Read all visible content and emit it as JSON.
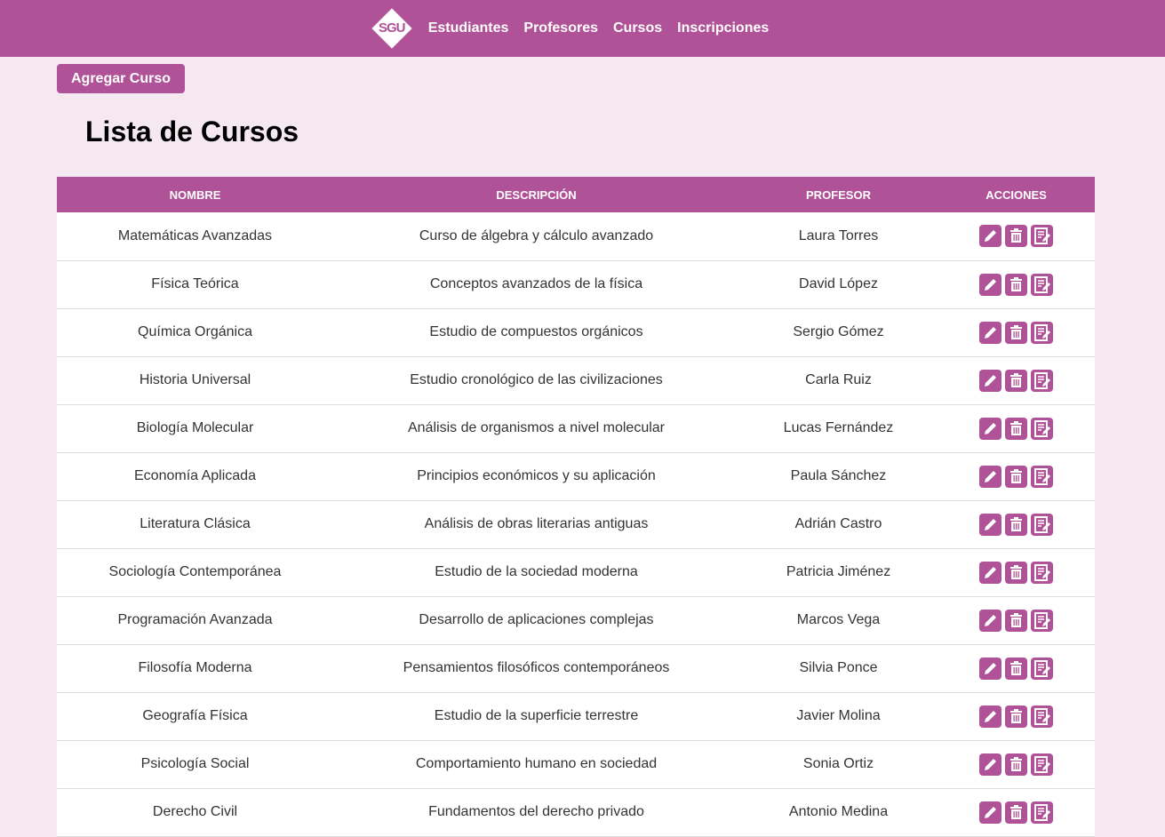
{
  "nav": {
    "logo": "SGU",
    "items": [
      "Estudiantes",
      "Profesores",
      "Cursos",
      "Inscripciones"
    ]
  },
  "add_button": "Agregar Curso",
  "title": "Lista de Cursos",
  "columns": [
    "NOMBRE",
    "DESCRIPCIÓN",
    "PROFESOR",
    "ACCIONES"
  ],
  "rows": [
    [
      "Matemáticas Avanzadas",
      "Curso de álgebra y cálculo avanzado",
      "Laura Torres"
    ],
    [
      "Física Teórica",
      "Conceptos avanzados de la física",
      "David López"
    ],
    [
      "Química Orgánica",
      "Estudio de compuestos orgánicos",
      "Sergio Gómez"
    ],
    [
      "Historia Universal",
      "Estudio cronológico de las civilizaciones",
      "Carla Ruiz"
    ],
    [
      "Biología Molecular",
      "Análisis de organismos a nivel molecular",
      "Lucas Fernández"
    ],
    [
      "Economía Aplicada",
      "Principios económicos y su aplicación",
      "Paula Sánchez"
    ],
    [
      "Literatura Clásica",
      "Análisis de obras literarias antiguas",
      "Adrián Castro"
    ],
    [
      "Sociología Contemporánea",
      "Estudio de la sociedad moderna",
      "Patricia Jiménez"
    ],
    [
      "Programación Avanzada",
      "Desarrollo de aplicaciones complejas",
      "Marcos Vega"
    ],
    [
      "Filosofía Moderna",
      "Pensamientos filosóficos contemporáneos",
      "Silvia Ponce"
    ],
    [
      "Geografía Física",
      "Estudio de la superficie terrestre",
      "Javier Molina"
    ],
    [
      "Psicología Social",
      "Comportamiento humano en sociedad",
      "Sonia Ortiz"
    ],
    [
      "Derecho Civil",
      "Fundamentos del derecho privado",
      "Antonio Medina"
    ]
  ]
}
